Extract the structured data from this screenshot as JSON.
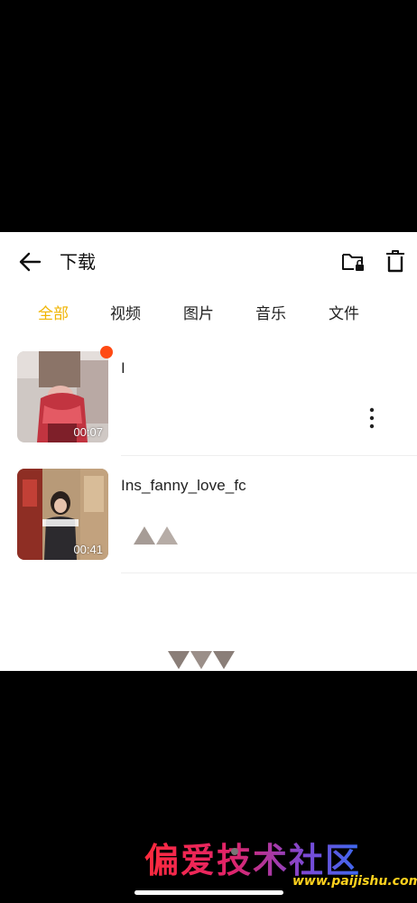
{
  "header": {
    "title": "下载",
    "icons": {
      "back": "arrow-left-icon",
      "folder": "folder-lock-icon",
      "delete": "trash-icon"
    }
  },
  "tabs": [
    {
      "label": "全部",
      "active": true
    },
    {
      "label": "视频",
      "active": false
    },
    {
      "label": "图片",
      "active": false
    },
    {
      "label": "音乐",
      "active": false
    },
    {
      "label": "文件",
      "active": false
    }
  ],
  "files": [
    {
      "name": "I",
      "duration": "00:07",
      "is_new": true
    },
    {
      "name": "Ins_fanny_love_fc                    _08.mp4",
      "duration": "00:41",
      "is_new": false
    }
  ],
  "watermark": {
    "title": "偏爱技术社区",
    "url": "www.paijishu.com"
  },
  "colors": {
    "accent": "#f0b400",
    "new_dot": "#ff4a14",
    "background": "#000000",
    "sheet": "#ffffff"
  }
}
